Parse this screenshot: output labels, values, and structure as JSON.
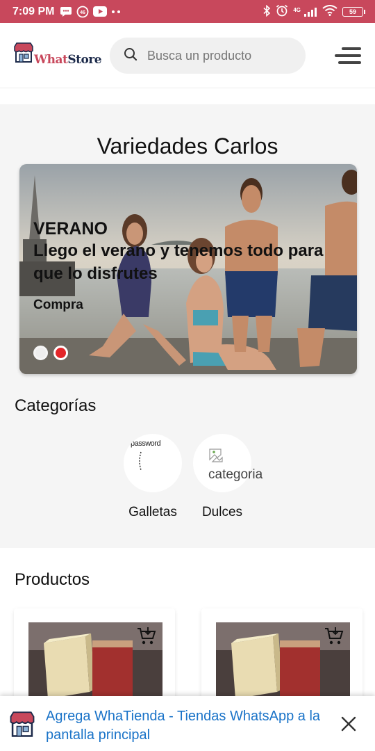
{
  "status_bar": {
    "time": "7:09 PM",
    "network_label": "4G",
    "battery": "59",
    "colors": {
      "background": "#c8485c"
    }
  },
  "header": {
    "logo": {
      "part1": "What",
      "part2": "Store"
    },
    "search": {
      "placeholder": "Busca un producto",
      "icon": "search-icon"
    },
    "menu_icon": "hamburger-menu-icon"
  },
  "store": {
    "name": "Variedades Carlos"
  },
  "banner": {
    "title": "VERANO",
    "subtitle": "Llego el verano y tenemos todo para que lo disfrutes",
    "cta": "Compra",
    "slides": 2,
    "active_slide": 2
  },
  "categories": {
    "title": "Categorías",
    "items": [
      {
        "name": "Galletas",
        "image_text": "password"
      },
      {
        "name": "Dulces",
        "image_alt": "categoria"
      }
    ]
  },
  "products": {
    "title": "Productos",
    "items": [
      {
        "image": "product-photo",
        "cart_icon": "add-to-cart-icon"
      },
      {
        "image": "product-photo",
        "cart_icon": "add-to-cart-icon"
      }
    ]
  },
  "install_prompt": {
    "text": "Agrega WhaTienda - Tiendas WhatsApp a la pantalla principal",
    "close_icon": "close-icon",
    "colors": {
      "link": "#1a73c8"
    }
  }
}
